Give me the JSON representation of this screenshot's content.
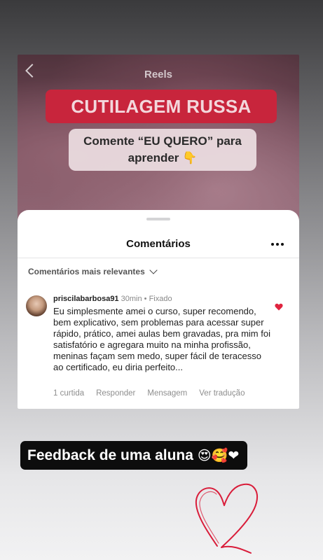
{
  "reel": {
    "nav_title": "Reels",
    "banner_text": "CUTILAGEM RUSSA",
    "card_line1": "Comente “EU QUERO” para",
    "card_line2": "aprender 👇"
  },
  "comments_sheet": {
    "title": "Comentários",
    "sort_label": "Comentários mais relevantes",
    "comment": {
      "username": "priscilabarbosa91",
      "time": "30min",
      "pinned": "Fixado",
      "text": "Eu simplesmente amei o curso, super recomendo, bem explicativo, sem problemas para acessar super rápido, prático, amei aulas bem gravadas, pra mim foi satisfatório e agregara muito na minha profissão, meninas façam sem medo, super fácil de teracesso ao certificado, eu diria perfeito...",
      "likes": "1 curtida",
      "reply": "Responder",
      "message": "Mensagem",
      "translate": "Ver tradução"
    }
  },
  "caption": {
    "text": "Feedback de uma aluna",
    "emojis": "😍🥰❤"
  },
  "colors": {
    "banner": "#c8253c",
    "heart": "#e0243f"
  }
}
